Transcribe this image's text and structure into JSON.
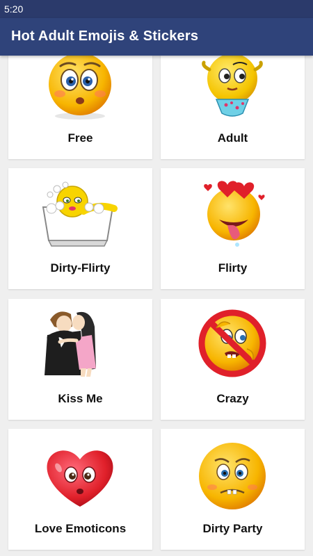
{
  "status_bar": {
    "time": "5:20"
  },
  "app_bar": {
    "title": "Hot Adult Emojis & Stickers"
  },
  "categories": [
    {
      "label": "Free",
      "icon": "wide-eyed-emoji-icon"
    },
    {
      "label": "Adult",
      "icon": "bikini-emoji-icon"
    },
    {
      "label": "Dirty-Flirty",
      "icon": "bathtub-emoji-icon"
    },
    {
      "label": "Flirty",
      "icon": "tongue-out-hearts-emoji-icon"
    },
    {
      "label": "Kiss Me",
      "icon": "kissing-couple-icon"
    },
    {
      "label": "Crazy",
      "icon": "no-sign-emoji-icon"
    },
    {
      "label": "Love Emoticons",
      "icon": "heart-face-emoji-icon"
    },
    {
      "label": "Dirty Party",
      "icon": "worried-emoji-icon"
    }
  ],
  "colors": {
    "app_bar": "#2f437a",
    "status_bar": "#2b3a6b",
    "background": "#efefef",
    "card": "#ffffff"
  }
}
